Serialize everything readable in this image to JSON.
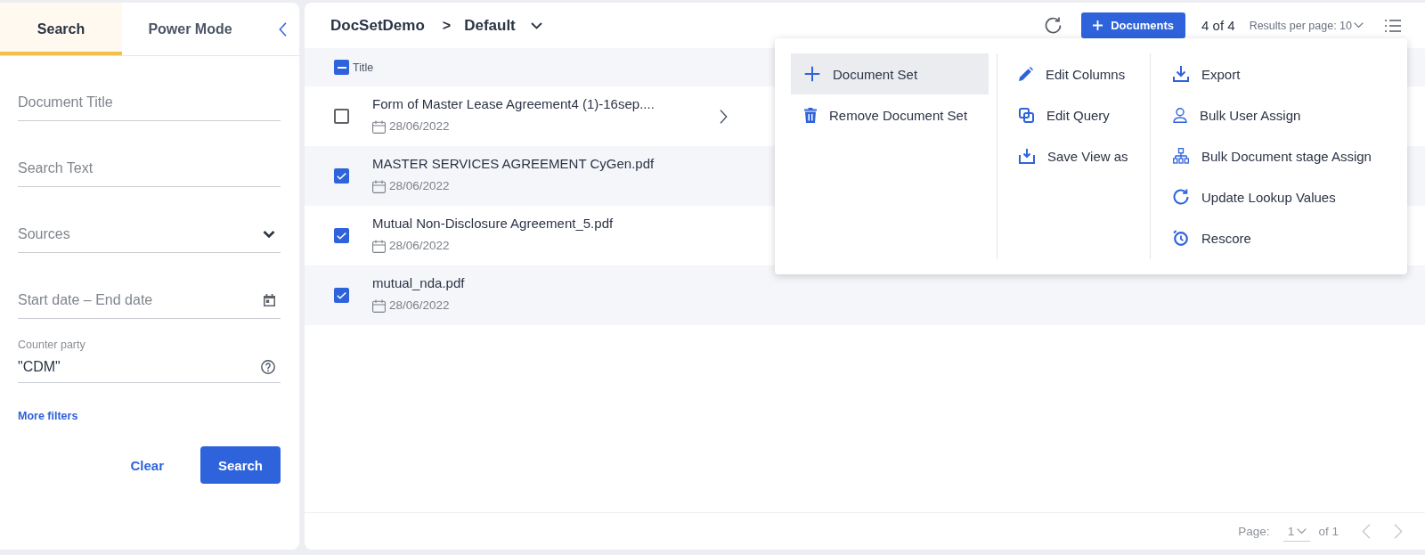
{
  "sidebar": {
    "tabs": [
      {
        "label": "Search",
        "selected": true
      },
      {
        "label": "Power Mode",
        "selected": false
      }
    ],
    "fields": [
      {
        "kind": "text",
        "placeholder": "Document Title"
      },
      {
        "kind": "text",
        "placeholder": "Search Text"
      },
      {
        "kind": "select",
        "placeholder": "Sources"
      },
      {
        "kind": "date",
        "placeholder": "Start date – End date"
      },
      {
        "kind": "labeled",
        "label": "Counter party",
        "value": "\"CDM\""
      }
    ],
    "more_filters": "More filters",
    "buttons": [
      {
        "kind": "text",
        "label": "Clear"
      },
      {
        "kind": "primary",
        "label": "Search"
      }
    ]
  },
  "toolbar": {
    "breadcrumb": {
      "root": "DocSetDemo",
      "separator": ">",
      "current": "Default"
    },
    "add_button": "Documents",
    "count": "4 of 4",
    "results_per_page": "Results per page: 10"
  },
  "table": {
    "select_all": {
      "indeterminate": true
    },
    "columns": [
      {
        "label": "Title"
      }
    ],
    "rows": [
      {
        "title": "Form of Master Lease Agreement4 (1)-16sep....",
        "date": "28/06/2022",
        "checked": false,
        "hovered": true
      },
      {
        "title": "MASTER SERVICES AGREEMENT CyGen.pdf",
        "date": "28/06/2022",
        "checked": true,
        "hovered": false
      },
      {
        "title": "Mutual Non-Disclosure Agreement_5.pdf",
        "date": "28/06/2022",
        "checked": true,
        "hovered": false
      },
      {
        "title": "mutual_nda.pdf",
        "date": "28/06/2022",
        "checked": true,
        "hovered": false
      }
    ]
  },
  "menu": {
    "columns": [
      {
        "items": [
          {
            "kind": "add",
            "label": "Document Set",
            "selected": true
          },
          {
            "kind": "remove",
            "label": "Remove Document Set",
            "selected": false
          }
        ]
      },
      {
        "items": [
          {
            "kind": "edit",
            "label": "Edit Columns",
            "selected": false
          },
          {
            "kind": "query",
            "label": "Edit Query",
            "selected": false
          },
          {
            "kind": "save",
            "label": "Save View as",
            "selected": false
          }
        ]
      },
      {
        "items": [
          {
            "kind": "export",
            "label": "Export",
            "selected": false
          },
          {
            "kind": "user",
            "label": "Bulk User Assign",
            "selected": false
          },
          {
            "kind": "stage",
            "label": "Bulk Document stage Assign",
            "selected": false
          },
          {
            "kind": "update",
            "label": "Update Lookup Values",
            "selected": false
          },
          {
            "kind": "rescore",
            "label": "Rescore",
            "selected": false
          }
        ]
      }
    ]
  },
  "footer": {
    "page_label": "Page:",
    "page": "1",
    "total": "of 1",
    "prev": {
      "disabled": true
    },
    "next": {
      "disabled": true
    }
  }
}
